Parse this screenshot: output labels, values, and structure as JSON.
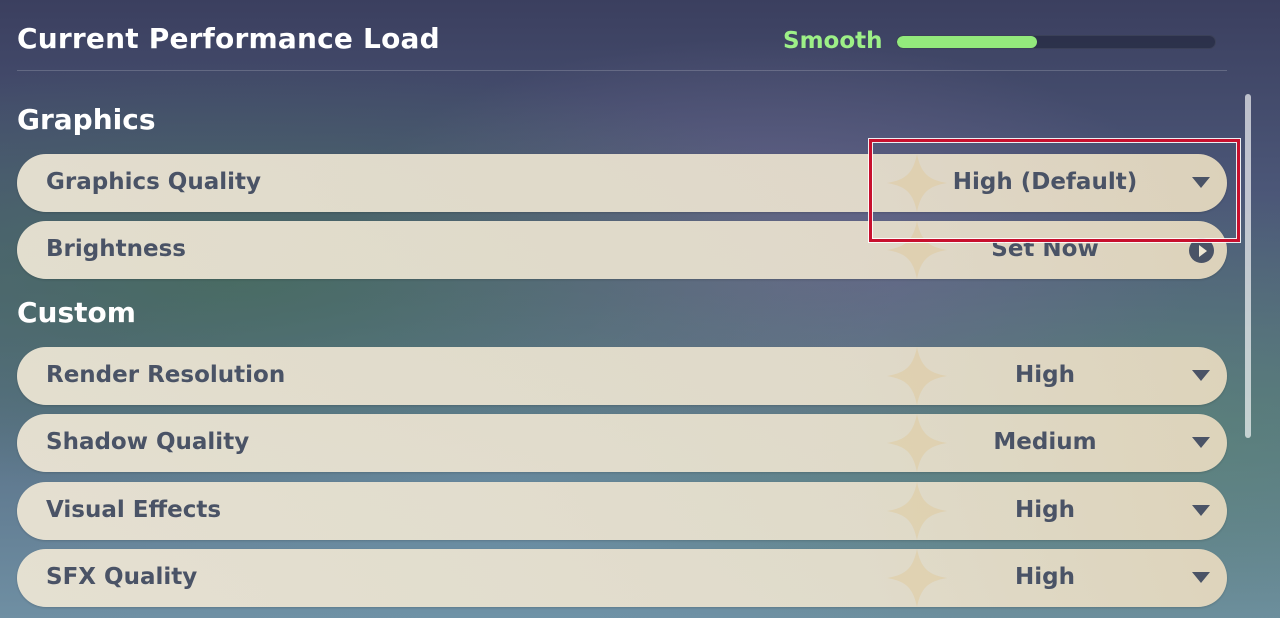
{
  "header": {
    "title": "Current Performance Load",
    "performance_status": "Smooth",
    "performance_fill": 0.44,
    "performance_color": "#93ea7c"
  },
  "sections": {
    "graphics": {
      "title": "Graphics",
      "graphics_quality": {
        "label": "Graphics Quality",
        "value": "High (Default)",
        "control_icon": "caret-down-icon"
      },
      "brightness": {
        "label": "Brightness",
        "value": "Set Now",
        "control_icon": "play-circle-icon"
      }
    },
    "custom": {
      "title": "Custom",
      "render_resolution": {
        "label": "Render Resolution",
        "value": "High",
        "control_icon": "caret-down-icon"
      },
      "shadow_quality": {
        "label": "Shadow Quality",
        "value": "Medium",
        "control_icon": "caret-down-icon"
      },
      "visual_effects": {
        "label": "Visual Effects",
        "value": "High",
        "control_icon": "caret-down-icon"
      },
      "sfx_quality": {
        "label": "SFX Quality",
        "value": "High",
        "control_icon": "caret-down-icon"
      }
    }
  },
  "highlight": {
    "color": "#c8102e",
    "target": "graphics-quality-dropdown"
  }
}
